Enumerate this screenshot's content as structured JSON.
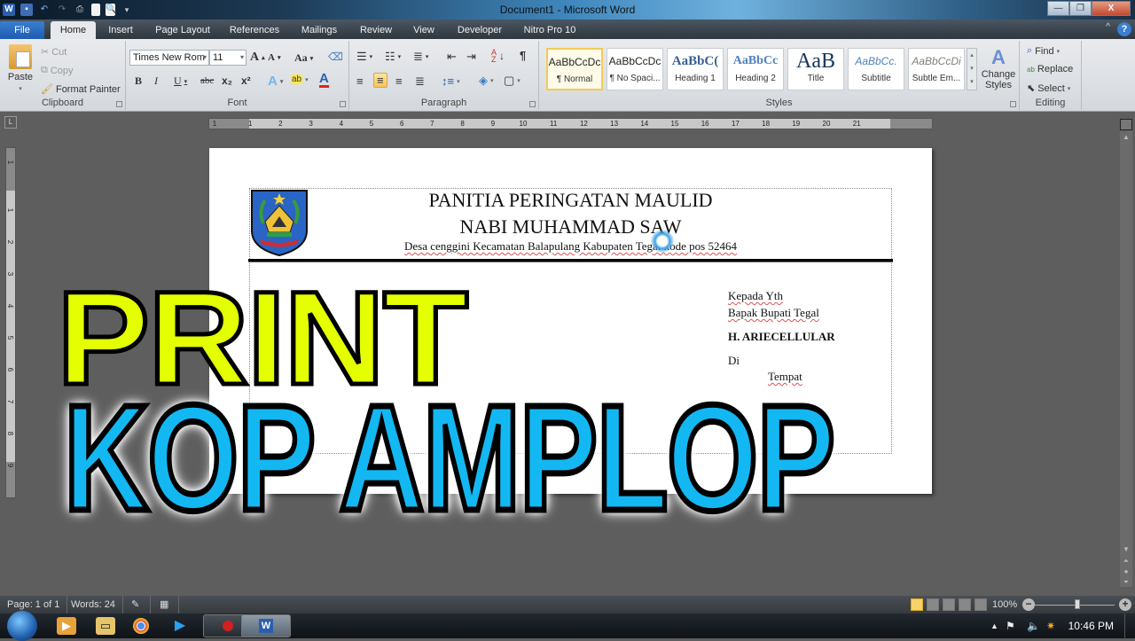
{
  "window": {
    "title": "Document1 - Microsoft Word",
    "quick_access": [
      "word-logo",
      "save",
      "undo",
      "redo",
      "quick-print",
      "new-document",
      "print-preview",
      "customize"
    ]
  },
  "tabs": [
    {
      "label": "File"
    },
    {
      "label": "Home"
    },
    {
      "label": "Insert"
    },
    {
      "label": "Page Layout"
    },
    {
      "label": "References"
    },
    {
      "label": "Mailings"
    },
    {
      "label": "Review"
    },
    {
      "label": "View"
    },
    {
      "label": "Developer"
    },
    {
      "label": "Nitro Pro 10"
    }
  ],
  "ribbon": {
    "clipboard": {
      "label": "Clipboard",
      "paste": "Paste",
      "cut": "Cut",
      "copy": "Copy",
      "format_painter": "Format Painter"
    },
    "font": {
      "label": "Font",
      "font_name": "Times New Rom",
      "font_size": "11",
      "bold": "B",
      "italic": "I",
      "underline": "U",
      "strike": "abc",
      "subscript": "x₂",
      "superscript": "x²",
      "grow": "A",
      "shrink": "A",
      "case": "Aa"
    },
    "paragraph": {
      "label": "Paragraph",
      "active_alignment": "center"
    },
    "styles": {
      "label": "Styles",
      "items": [
        {
          "sample": "AaBbCcDc",
          "name": "¶ Normal"
        },
        {
          "sample": "AaBbCcDc",
          "name": "¶ No Spaci..."
        },
        {
          "sample": "AaBbC(",
          "name": "Heading 1"
        },
        {
          "sample": "AaBbCc",
          "name": "Heading 2"
        },
        {
          "sample": "AaB",
          "name": "Title"
        },
        {
          "sample": "AaBbCc.",
          "name": "Subtitle"
        },
        {
          "sample": "AaBbCcDi",
          "name": "Subtle Em..."
        }
      ],
      "selected_index": 0,
      "change_styles": "Change Styles"
    },
    "editing": {
      "label": "Editing",
      "find": "Find",
      "replace": "Replace",
      "select": "Select"
    }
  },
  "ruler": {
    "horizontal": [
      "1",
      "1",
      "2",
      "3",
      "4",
      "5",
      "6",
      "7",
      "8",
      "9",
      "10",
      "11",
      "12",
      "13",
      "14",
      "15",
      "16",
      "17",
      "18",
      "19",
      "20",
      "21"
    ],
    "vertical": [
      "1",
      "1",
      "2",
      "3",
      "4",
      "5",
      "6",
      "7",
      "8",
      "9"
    ]
  },
  "document": {
    "header_line1": "PANITIA PERINGATAN MAULID",
    "header_line2": "NABI MUHAMMAD SAW",
    "header_line3": "Desa cenggini Kecamatan Balapulang Kabupaten Tegal kode pos 52464",
    "address": {
      "line1": "Kepada Yth",
      "line2": "Bapak Bupati Tegal",
      "name": "H. ARIECELLULAR",
      "line4": "Di",
      "line5": "Tempat"
    }
  },
  "overlay": {
    "title1": "PRINT",
    "title2": "KOP AMPLOP",
    "color1": "#e4ff00",
    "color2": "#13b8f2"
  },
  "statusbar": {
    "page": "Page: 1 of 1",
    "words": "Words: 24",
    "zoom": "100%",
    "zoom_percent": 100
  },
  "taskbar": {
    "clock": "10:46 PM",
    "apps": [
      "media-player",
      "file-explorer",
      "chrome",
      "video-player",
      "screen-recorder",
      "microsoft-word"
    ]
  }
}
